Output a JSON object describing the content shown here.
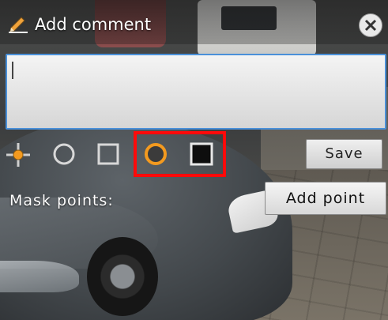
{
  "dialog": {
    "title": "Add comment",
    "title_icon": "pencil-icon",
    "close_icon": "close-icon"
  },
  "comment": {
    "value": "",
    "placeholder": ""
  },
  "tools": {
    "items": [
      {
        "name": "crosshair-icon",
        "selected": false
      },
      {
        "name": "circle-outline-icon",
        "selected": false
      },
      {
        "name": "square-outline-icon",
        "selected": false
      },
      {
        "name": "circle-filled-icon",
        "selected": true
      },
      {
        "name": "square-filled-icon",
        "selected": true
      }
    ],
    "highlight_color": "#ff0a0a",
    "filled_circle_color": "#f39a1f"
  },
  "buttons": {
    "save_label": "Save",
    "add_point_label": "Add point"
  },
  "mask": {
    "label": "Mask points:"
  },
  "colors": {
    "field_border": "#4a90d9",
    "title_text": "#ffffff"
  }
}
